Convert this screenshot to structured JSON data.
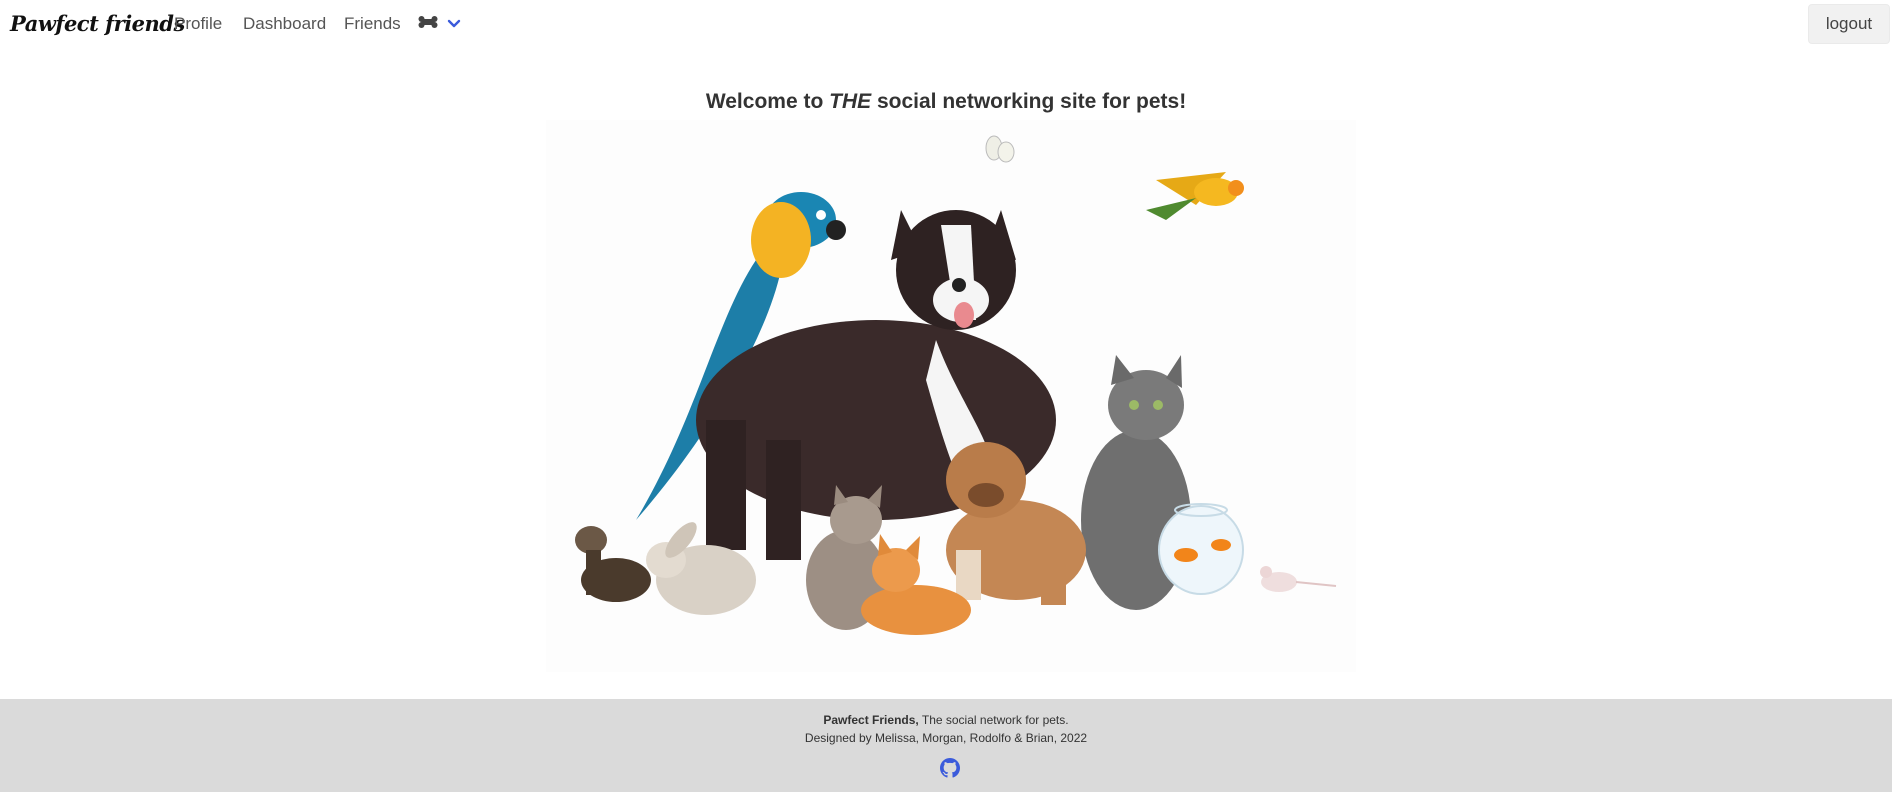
{
  "navbar": {
    "brand": "Pawfect friends",
    "links": [
      {
        "label": "Profile"
      },
      {
        "label": "Dashboard"
      },
      {
        "label": "Friends"
      }
    ],
    "menu_icon": "bone-icon",
    "menu_chevron_icon": "chevron-down-icon",
    "logout_label": "logout"
  },
  "main": {
    "welcome_prefix": "Welcome to ",
    "welcome_emphasis": "THE",
    "welcome_suffix": " social networking site for pets!",
    "hero_image": "pets-group-photo"
  },
  "footer": {
    "site_name": "Pawfect Friends,",
    "tagline": " The social network for pets.",
    "credits": "Designed by Melissa, Morgan, Rodolfo & Brian, 2022",
    "github_icon": "github-icon"
  },
  "colors": {
    "chevron": "#3b5bdb",
    "footer_bg": "#dadada",
    "github": "#3b5bdb"
  }
}
